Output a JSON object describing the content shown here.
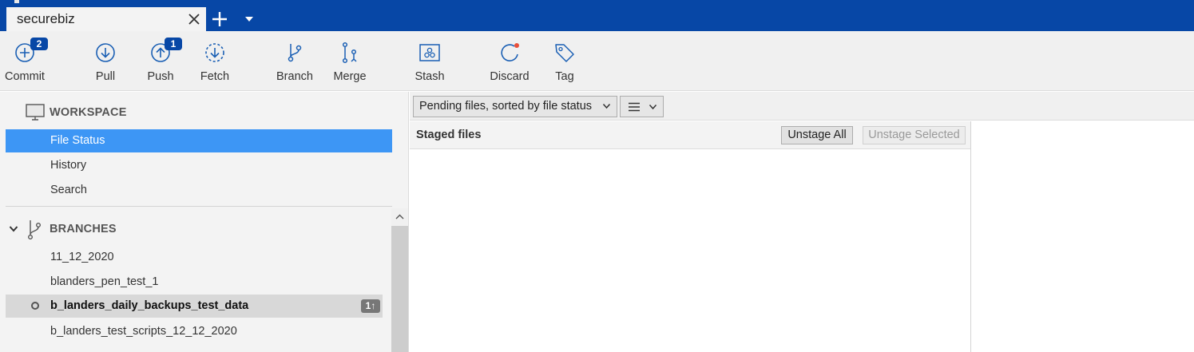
{
  "tab": {
    "title": "securebiz"
  },
  "toolbar": {
    "commit": {
      "label": "Commit",
      "badge": "2"
    },
    "pull": {
      "label": "Pull"
    },
    "push": {
      "label": "Push",
      "badge": "1"
    },
    "fetch": {
      "label": "Fetch"
    },
    "branch": {
      "label": "Branch"
    },
    "merge": {
      "label": "Merge"
    },
    "stash": {
      "label": "Stash"
    },
    "discard": {
      "label": "Discard"
    },
    "tag": {
      "label": "Tag"
    }
  },
  "sidebar": {
    "workspace": {
      "title": "WORKSPACE",
      "items": [
        {
          "label": "File Status",
          "active": true
        },
        {
          "label": "History"
        },
        {
          "label": "Search"
        }
      ]
    },
    "branches": {
      "title": "BRANCHES",
      "items": [
        {
          "label": "11_12_2020"
        },
        {
          "label": "blanders_pen_test_1"
        },
        {
          "label": "b_landers_daily_backups_test_data",
          "current": true,
          "badge": "1↑"
        },
        {
          "label": "b_landers_test_scripts_12_12_2020"
        }
      ]
    }
  },
  "main": {
    "sort_select": "Pending files, sorted by file status",
    "staged": {
      "title": "Staged files",
      "unstage_all": "Unstage All",
      "unstage_selected": "Unstage Selected"
    }
  },
  "colors": {
    "titlebar": "#0747a6",
    "accent": "#3d96f5",
    "icon": "#1a5fb4",
    "discard_dot": "#e8503a"
  }
}
